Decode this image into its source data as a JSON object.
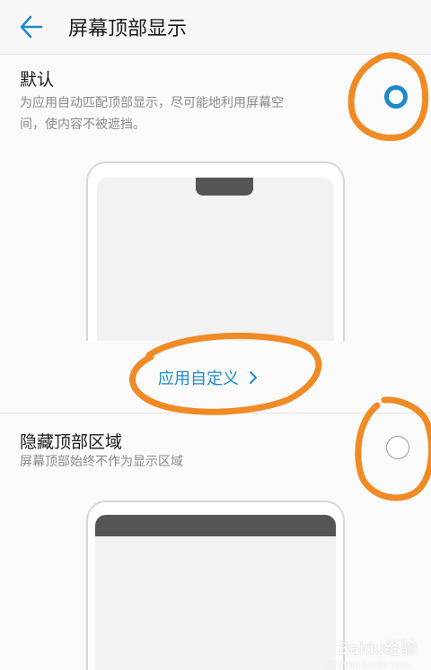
{
  "header": {
    "title": "屏幕顶部显示",
    "back_icon": "arrow-left-icon"
  },
  "option_default": {
    "title": "默认",
    "desc_line1": "为应用自动匹配顶部显示，尽可能地利用屏幕空",
    "desc_line2": "间，使内容不被遮挡。",
    "selected": true
  },
  "custom_link": {
    "label": "应用自定义"
  },
  "option_hide": {
    "title": "隐藏顶部区域",
    "desc": "屏幕顶部始终不作为显示区域",
    "selected": false
  },
  "watermark": {
    "text": "Baidu经验",
    "sub": "jingyan.baidu.com"
  },
  "colors": {
    "accent": "#1e8ac9",
    "annotation": "#f08a24"
  }
}
